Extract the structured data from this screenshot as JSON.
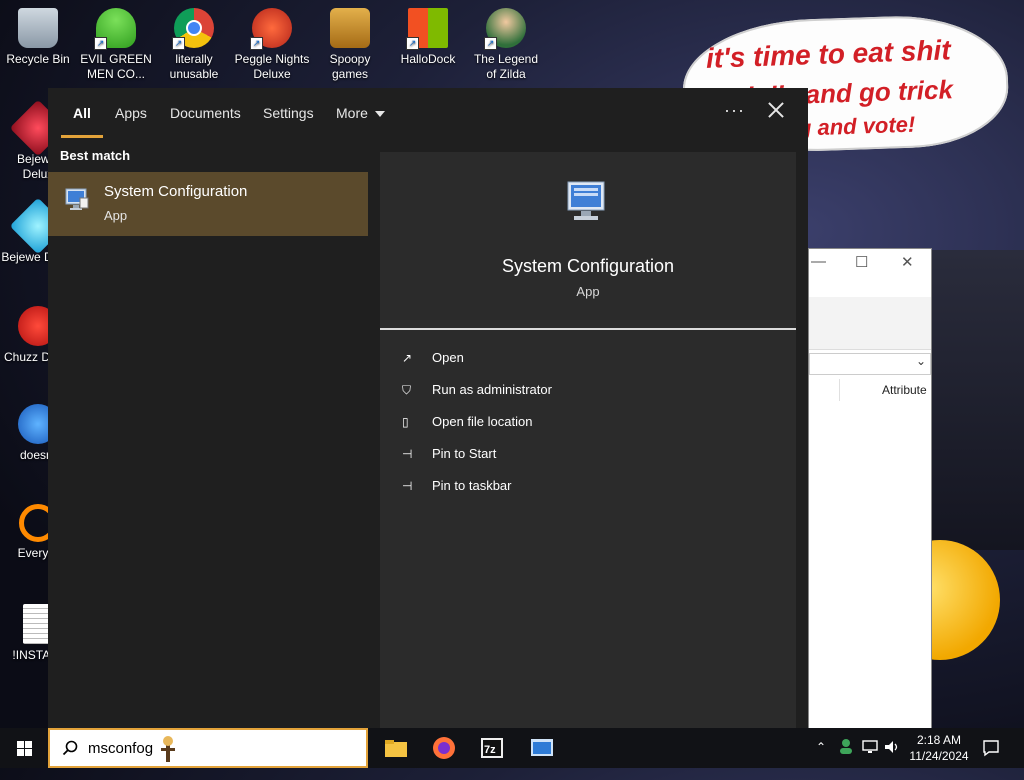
{
  "desktop": {
    "icons": [
      {
        "label": "Recycle Bin"
      },
      {
        "label": "EVIL GREEN MEN CO..."
      },
      {
        "label": "literally unusable"
      },
      {
        "label": "Peggle Nights Deluxe"
      },
      {
        "label": "Spoopy games"
      },
      {
        "label": "HalloDock"
      },
      {
        "label": "The Legend of Zilda"
      },
      {
        "label": "Bejewel Delux"
      },
      {
        "label": "Bejewe Delux"
      },
      {
        "label": "Chuzz Delux"
      },
      {
        "label": "doesnt"
      },
      {
        "label": "Everyth"
      },
      {
        "label": "!INSTALL"
      }
    ],
    "speech_bubble": {
      "line1": "it's time to eat shit",
      "line2": "and die and go trick",
      "line3": "ng and vote!"
    }
  },
  "background_window": {
    "column_header": "Attribute",
    "dropdown_glyph": "⌄"
  },
  "search_panel": {
    "tabs": [
      {
        "label": "All",
        "active": true
      },
      {
        "label": "Apps",
        "active": false
      },
      {
        "label": "Documents",
        "active": false
      },
      {
        "label": "Settings",
        "active": false
      },
      {
        "label": "More",
        "active": false
      }
    ],
    "options_glyph": "···",
    "best_match_heading": "Best match",
    "best_match": {
      "title": "System Configuration",
      "subtitle": "App"
    },
    "detail": {
      "title": "System Configuration",
      "subtitle": "App",
      "actions": [
        {
          "label": "Open",
          "icon": "open-icon"
        },
        {
          "label": "Run as administrator",
          "icon": "shield-icon"
        },
        {
          "label": "Open file location",
          "icon": "file-location-icon"
        },
        {
          "label": "Pin to Start",
          "icon": "pin-icon"
        },
        {
          "label": "Pin to taskbar",
          "icon": "pin-icon"
        }
      ]
    },
    "accent_color": "#e3a33a"
  },
  "taskbar": {
    "search_value": "msconfog",
    "clock_time": "2:18 AM",
    "clock_date": "11/24/2024",
    "pinned": [
      "file-explorer-icon",
      "firefox-icon",
      "7zip-icon",
      "app-window-icon"
    ]
  }
}
